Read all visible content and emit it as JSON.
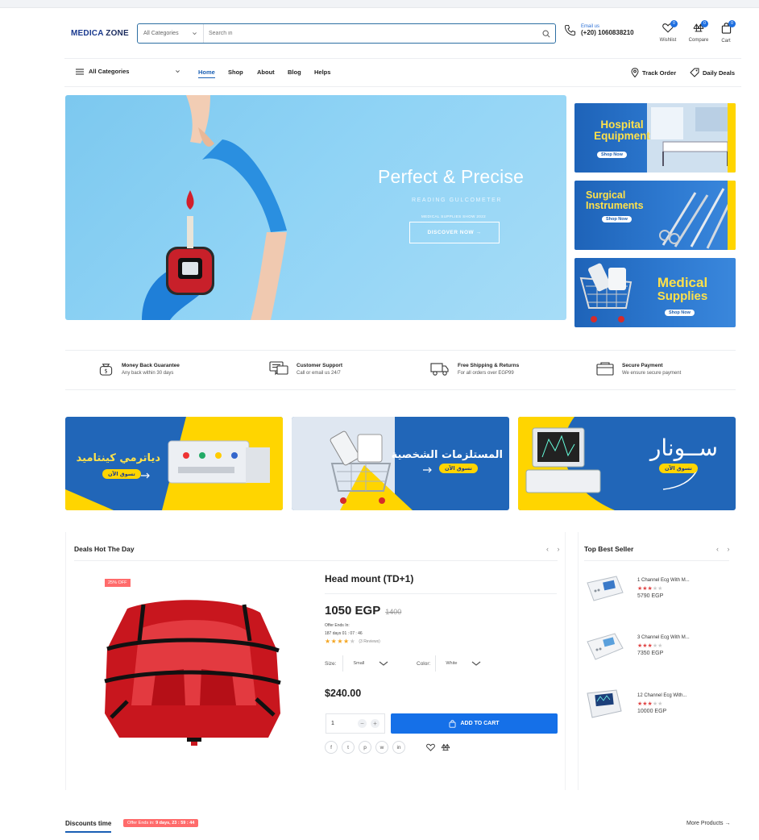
{
  "header": {
    "logo_part1": "MEDICA",
    "logo_part2": "ZONE",
    "search_category": "All Categories",
    "search_placeholder": "Search in",
    "email_label": "Email us",
    "phone": "(+20) 1060838210",
    "icons": [
      {
        "icon": "heart-icon",
        "label": "Wishlist",
        "count": "0"
      },
      {
        "icon": "compare-icon",
        "label": "Compare",
        "count": "0"
      },
      {
        "icon": "bag-icon",
        "label": "Cart",
        "count": "0"
      }
    ]
  },
  "nav": {
    "all_categories": "All Categories",
    "links": [
      "Home",
      "Shop",
      "About",
      "Blog",
      "Helps"
    ],
    "active": "Home",
    "track_order": "Track Order",
    "daily_deals": "Daily Deals"
  },
  "hero": {
    "title": "Perfect & Precise",
    "subtitle": "READING GULCOMETER",
    "small": "MEDICAL SUPPLIES SHOW 2022",
    "button": "DISCOVER NOW →"
  },
  "side_banners": [
    {
      "title_line1": "Hospital",
      "title_line2": "Equipment",
      "cta": "Shop Now"
    },
    {
      "title_line1": "Surgical",
      "title_line2": "Instruments",
      "cta": "Shop Now"
    },
    {
      "title_line1": "Medical",
      "title_line2": "Supplies",
      "cta": "Shop Now"
    }
  ],
  "features": [
    {
      "icon": "money-bag-icon",
      "title": "Money Back Guarantee",
      "sub": "Any back within 30 days"
    },
    {
      "icon": "chat-icon",
      "title": "Customer Support",
      "sub": "Call or email us 24/7"
    },
    {
      "icon": "truck-icon",
      "title": "Free Shipping & Returns",
      "sub": "For all orders over EGP99"
    },
    {
      "icon": "wallet-icon",
      "title": "Secure Payment",
      "sub": "We ensure secure payment"
    }
  ],
  "promos": [
    {
      "headline": "دياترمي كينتاميد",
      "cta": "تسوق الآن"
    },
    {
      "headline": "المستلزمات الشخصية",
      "cta": "تسوق الآن"
    },
    {
      "headline": "ســونار",
      "cta": "تسوق الآن"
    }
  ],
  "deals": {
    "section_title": "Deals Hot The Day",
    "discount": "25% OFF",
    "product_name": "Head mount (TD+1)",
    "price": "1050 EGP",
    "old_price": "1400",
    "offer_label": "Offer Ends In:",
    "offer_time": "187 days 01 : 07 : 46",
    "rating": 4,
    "reviews": "(3 Reviews)",
    "size_label": "Size:",
    "size_value": "Small",
    "color_label": "Color:",
    "color_value": "White",
    "variant_price": "$240.00",
    "qty": "1",
    "add_to_cart": "ADD TO CART",
    "social": [
      "f",
      "t",
      "p",
      "w",
      "in"
    ]
  },
  "best_seller": {
    "section_title": "Top Best Seller",
    "items": [
      {
        "name": "1 Channel Ecg With M...",
        "price": "5790 EGP",
        "rating": 3
      },
      {
        "name": "3 Channel Ecg With M...",
        "price": "7350 EGP",
        "rating": 3
      },
      {
        "name": "12 Channel Ecg With...",
        "price": "10000 EGP",
        "rating": 3
      }
    ]
  },
  "discounts": {
    "title": "Discounts time",
    "tag_prefix": "Offer Ends in: ",
    "tag_time": "9 days, 23 : 59 : 44",
    "more": "More Products →"
  },
  "colors": {
    "brand_blue": "#1a5fb4",
    "cart_button": "#1570e8",
    "promo_yellow": "#ffd500",
    "discount_red": "#ff6b6b"
  }
}
